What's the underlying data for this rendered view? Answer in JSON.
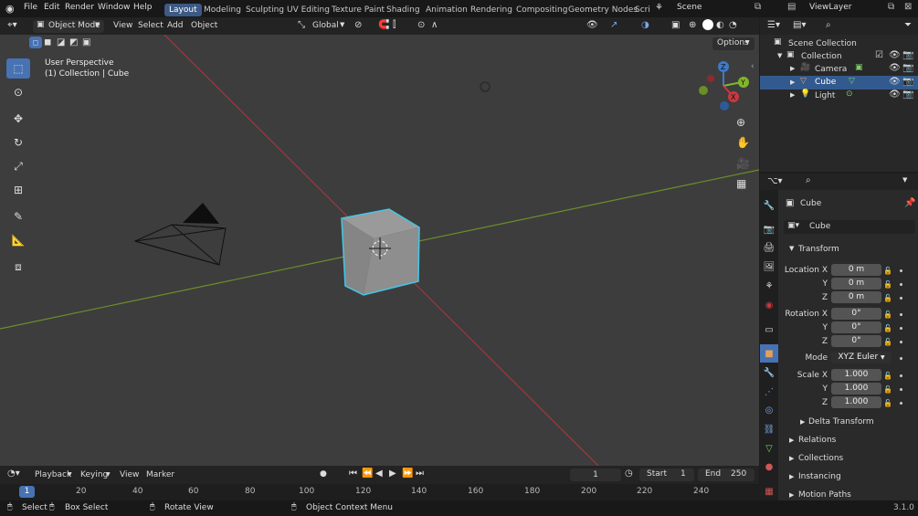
{
  "menu": {
    "file": "File",
    "edit": "Edit",
    "render": "Render",
    "window": "Window",
    "help": "Help"
  },
  "workspaces": [
    "Layout",
    "Modeling",
    "Sculpting",
    "UV Editing",
    "Texture Paint",
    "Shading",
    "Animation",
    "Rendering",
    "Compositing",
    "Geometry Nodes",
    "Scri"
  ],
  "scene": "Scene",
  "viewlayer": "ViewLayer",
  "header": {
    "mode": "Object Mode",
    "view": "View",
    "select": "Select",
    "add": "Add",
    "object": "Object",
    "orientation": "Global",
    "options": "Options"
  },
  "viewport": {
    "perspective": "User Perspective",
    "context": "(1) Collection | Cube"
  },
  "outliner": {
    "scene_collection": "Scene Collection",
    "collection": "Collection",
    "items": [
      {
        "name": "Camera"
      },
      {
        "name": "Cube"
      },
      {
        "name": "Light"
      }
    ]
  },
  "props": {
    "object_name": "Cube",
    "data_name": "Cube",
    "transform": "Transform",
    "location_label": "Location X",
    "rotation_label": "Rotation X",
    "scale_label": "Scale X",
    "y": "Y",
    "z": "Z",
    "loc": [
      "0 m",
      "0 m",
      "0 m"
    ],
    "rot": [
      "0°",
      "0°",
      "0°"
    ],
    "scale": [
      "1.000",
      "1.000",
      "1.000"
    ],
    "mode_label": "Mode",
    "mode_value": "XYZ Euler",
    "delta": "Delta Transform",
    "relations": "Relations",
    "collections": "Collections",
    "instancing": "Instancing",
    "motion_paths": "Motion Paths"
  },
  "timeline": {
    "playback": "Playback",
    "keying": "Keying",
    "view": "View",
    "marker": "Marker",
    "current": "1",
    "start_label": "Start",
    "start": "1",
    "end_label": "End",
    "end": "250",
    "ticks": [
      "1",
      "20",
      "40",
      "60",
      "80",
      "100",
      "120",
      "140",
      "160",
      "180",
      "200",
      "220",
      "240"
    ]
  },
  "status": {
    "select": "Select",
    "box_select": "Box Select",
    "rotate_view": "Rotate View",
    "context_menu": "Object Context Menu",
    "version": "3.1.0"
  },
  "colors": {
    "accent": "#4772b3",
    "selected_row": "#335a8f",
    "x_axis": "#c9383f",
    "y_axis": "#82b62a",
    "z_axis": "#3f79c9",
    "outline": "#44c6e8"
  }
}
